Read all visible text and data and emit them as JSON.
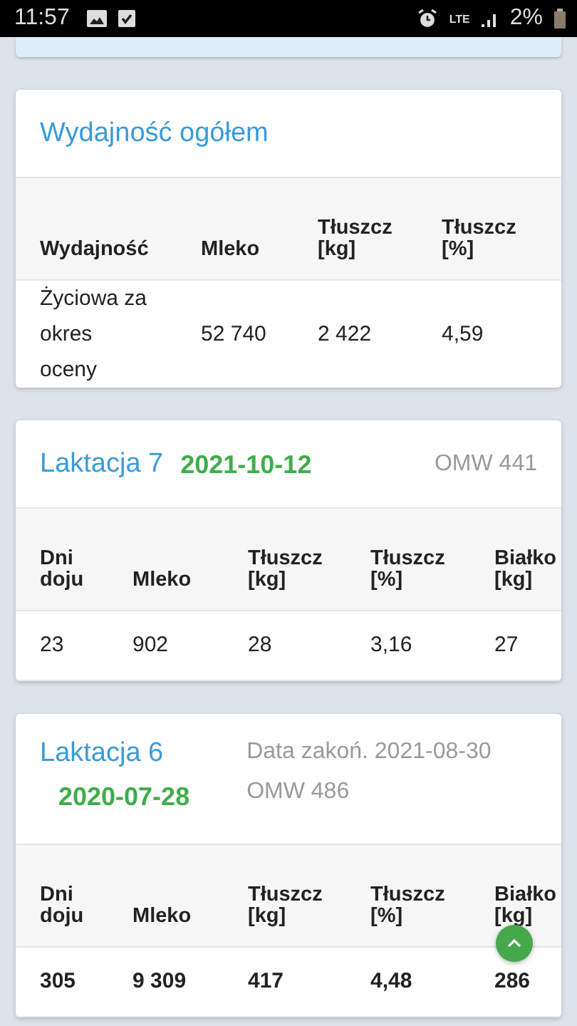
{
  "status_bar": {
    "time": "11:57",
    "battery_text": "2%",
    "network": "LTE"
  },
  "cards": [
    {
      "kind": "overall",
      "title": "Wydajność ogółem",
      "columns": [
        "Wydajność",
        "Mleko",
        "Tłuszcz [kg]",
        "Tłuszcz [%]"
      ],
      "rows": [
        {
          "bold": false,
          "cells": [
            "Życiowa za okres oceny",
            "52 740",
            "2 422",
            "4,59"
          ]
        }
      ]
    },
    {
      "kind": "inline",
      "title": "Laktacja 7",
      "date": "2021-10-12",
      "omw": "OMW 441",
      "columns": [
        "Dni doju",
        "Mleko",
        "Tłuszcz [kg]",
        "Tłuszcz [%]",
        "Białko [kg]"
      ],
      "rows": [
        {
          "bold": false,
          "cells": [
            "23",
            "902",
            "28",
            "3,16",
            "27"
          ]
        }
      ]
    },
    {
      "kind": "stacked",
      "title": "Laktacja 6",
      "date": "2020-07-28",
      "end_date": "Data zakoń. 2021-08-30",
      "omw": "OMW 486",
      "columns": [
        "Dni doju",
        "Mleko",
        "Tłuszcz [kg]",
        "Tłuszcz [%]",
        "Białko [kg]"
      ],
      "rows": [
        {
          "bold": true,
          "cells": [
            "305",
            "9 309",
            "417",
            "4,48",
            "286"
          ]
        }
      ]
    }
  ]
}
